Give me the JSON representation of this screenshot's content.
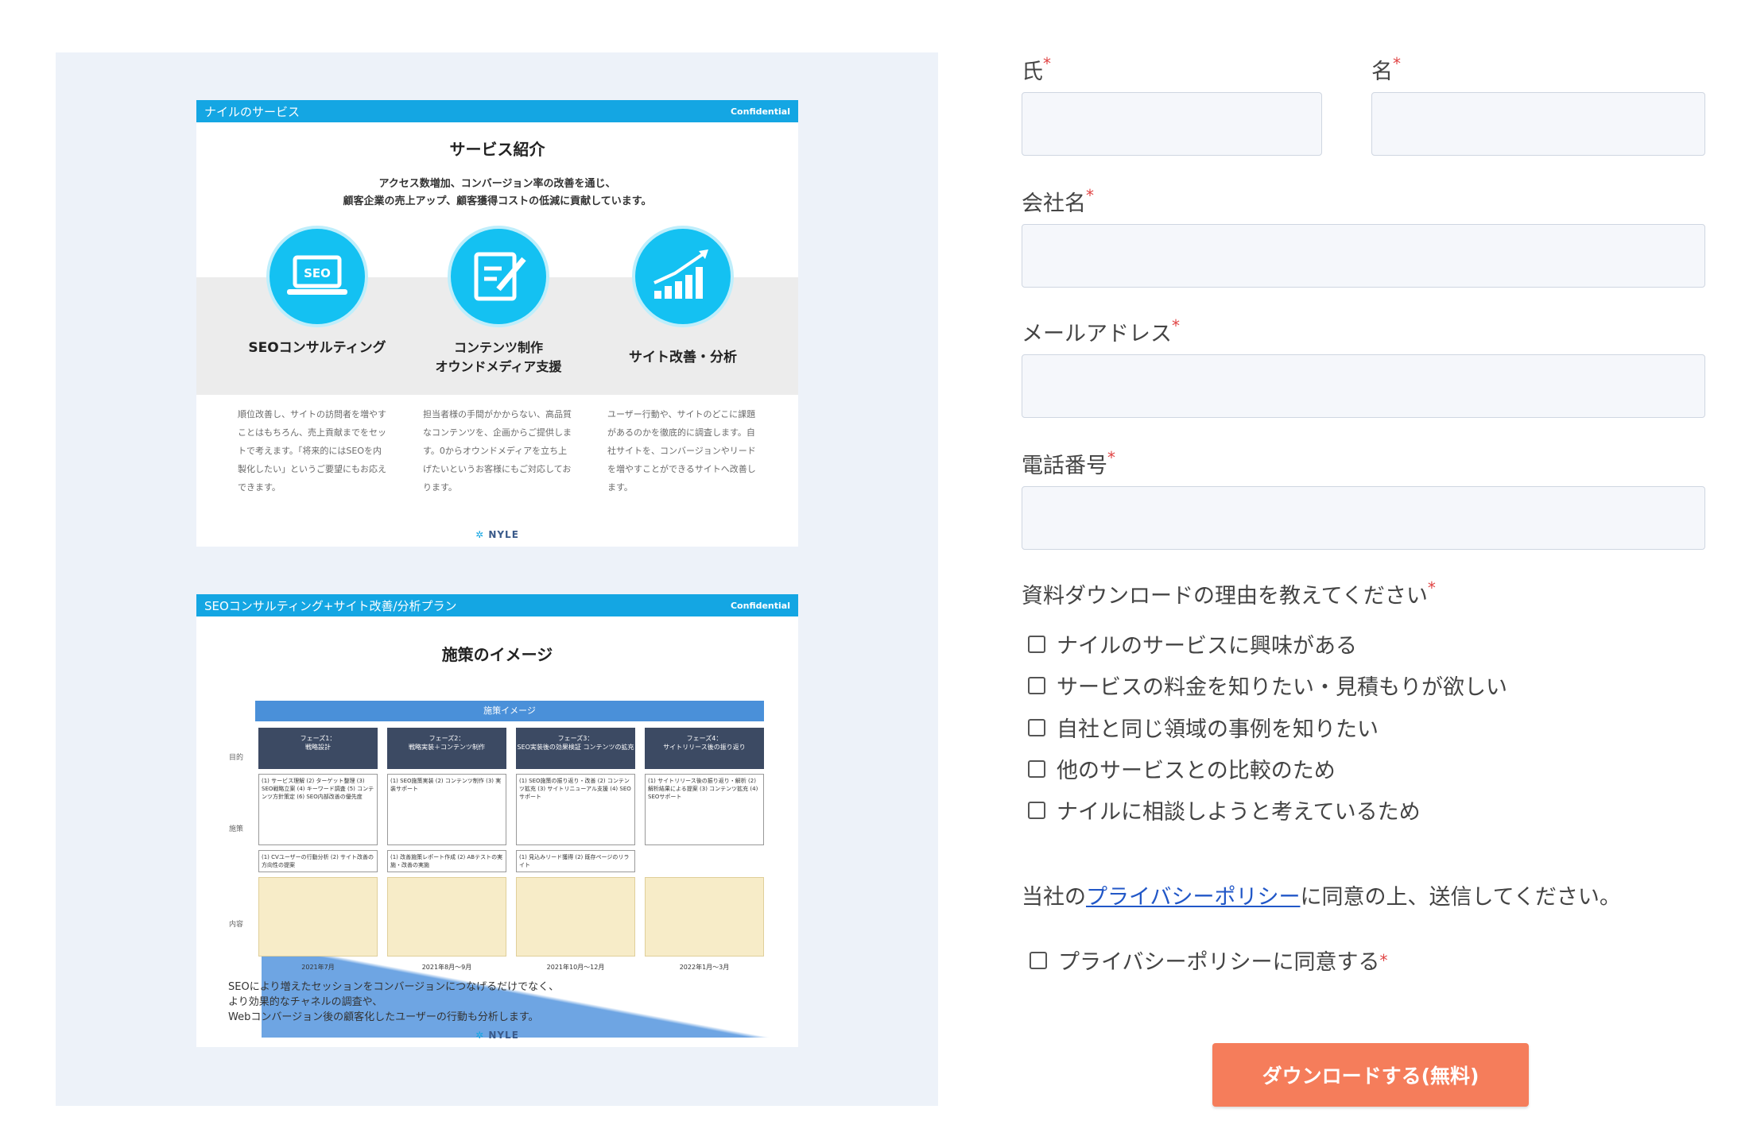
{
  "slide1": {
    "bar_title": "ナイルのサービス",
    "confidential": "Confidential",
    "title": "サービス紹介",
    "lead_line1": "アクセス数増加、コンバージョン率の改善を通じ、",
    "lead_line2": "顧客企業の売上アップ、顧客獲得コストの低減に貢献しています。",
    "services": [
      {
        "badge": "SEO",
        "name": "SEOコンサルティング",
        "desc": "順位改善し、サイトの訪問者を増やすことはもちろん、売上貢献までをセットで考えます。「将来的にはSEOを内製化したい」というご要望にもお応えできます。"
      },
      {
        "name_line1": "コンテンツ制作",
        "name_line2": "オウンドメディア支援",
        "desc": "担当者様の手間がかからない、高品質なコンテンツを、企画からご提供します。0からオウンドメディアを立ち上げたいというお客様にもご対応しております。"
      },
      {
        "name": "サイト改善・分析",
        "desc": "ユーザー行動や、サイトのどこに課題があるのかを徹底的に調査します。自社サイトを、コンバージョンやリードを増やすことができるサイトへ改善します。"
      }
    ],
    "logo": "NYLE"
  },
  "slide2": {
    "bar_title": "SEOコンサルティング+サイト改善/分析プラン",
    "confidential": "Confidential",
    "title": "施策のイメージ",
    "plan_header": "施策イメージ",
    "row_labels": [
      "目的",
      "施策",
      "内容"
    ],
    "phases": [
      {
        "head1": "フェーズ1：",
        "head2": "戦略設計",
        "body": "(1) サービス理解 (2) ターゲット整理 (3) SEO戦略立案 (4) キーワード調査 (5) コンテンツ方針策定 (6) SEO内部改善の優先度",
        "sub": "(1) CVユーザーの行動分析 (2) サイト改善の方向性の提案",
        "period": "2021年7月"
      },
      {
        "head1": "フェーズ2：",
        "head2": "戦略実装＋コンテンツ制作",
        "body": "(1) SEO施策実装 (2) コンテンツ制作 (3) 実装サポート",
        "sub": "(1) 改善施策レポート作成 (2) ABテストの実施・改善の実施",
        "period": "2021年8月～9月"
      },
      {
        "head1": "フェーズ3：",
        "head2": "SEO実装後の効果検証 コンテンツの拡充",
        "body": "(1) SEO施策の振り返り・改善 (2) コンテンツ拡充 (3) サイトリニューアル支援 (4) SEOサポート",
        "sub": "(1) 見込みリード獲得 (2) 既存ページのリライト",
        "period": "2021年10月～12月"
      },
      {
        "head1": "フェーズ4：",
        "head2": "サイトリリース後の振り返り",
        "body": "(1) サイトリリース後の振り返り・解析 (2) 解析結果による提案 (3) コンテンツ拡充 (4) SEOサポート",
        "sub": "",
        "period": "2022年1月～3月"
      }
    ],
    "desc_line1": "SEOにより増えたセッションをコンバージョンにつなげるだけでなく、",
    "desc_line2": "より効果的なチャネルの調査や、",
    "desc_line3": "Webコンバージョン後の顧客化したユーザーの行動も分析します。",
    "logo": "NYLE"
  },
  "form": {
    "last_name_label": "氏",
    "first_name_label": "名",
    "company_label": "会社名",
    "email_label": "メールアドレス",
    "phone_label": "電話番号",
    "required_mark": "*",
    "reason_title": "資料ダウンロードの理由を教えてください",
    "reasons": [
      "ナイルのサービスに興味がある",
      "サービスの料金を知りたい・見積もりが欲しい",
      "自社と同じ領域の事例を知りたい",
      "他のサービスとの比較のため",
      "ナイルに相談しようと考えているため"
    ],
    "policy_prefix": "当社の",
    "policy_link": "プライバシーポリシー",
    "policy_suffix": "に同意の上、送信してください。",
    "policy_agree": "プライバシーポリシーに同意する",
    "submit_label": "ダウンロードする(無料)"
  }
}
